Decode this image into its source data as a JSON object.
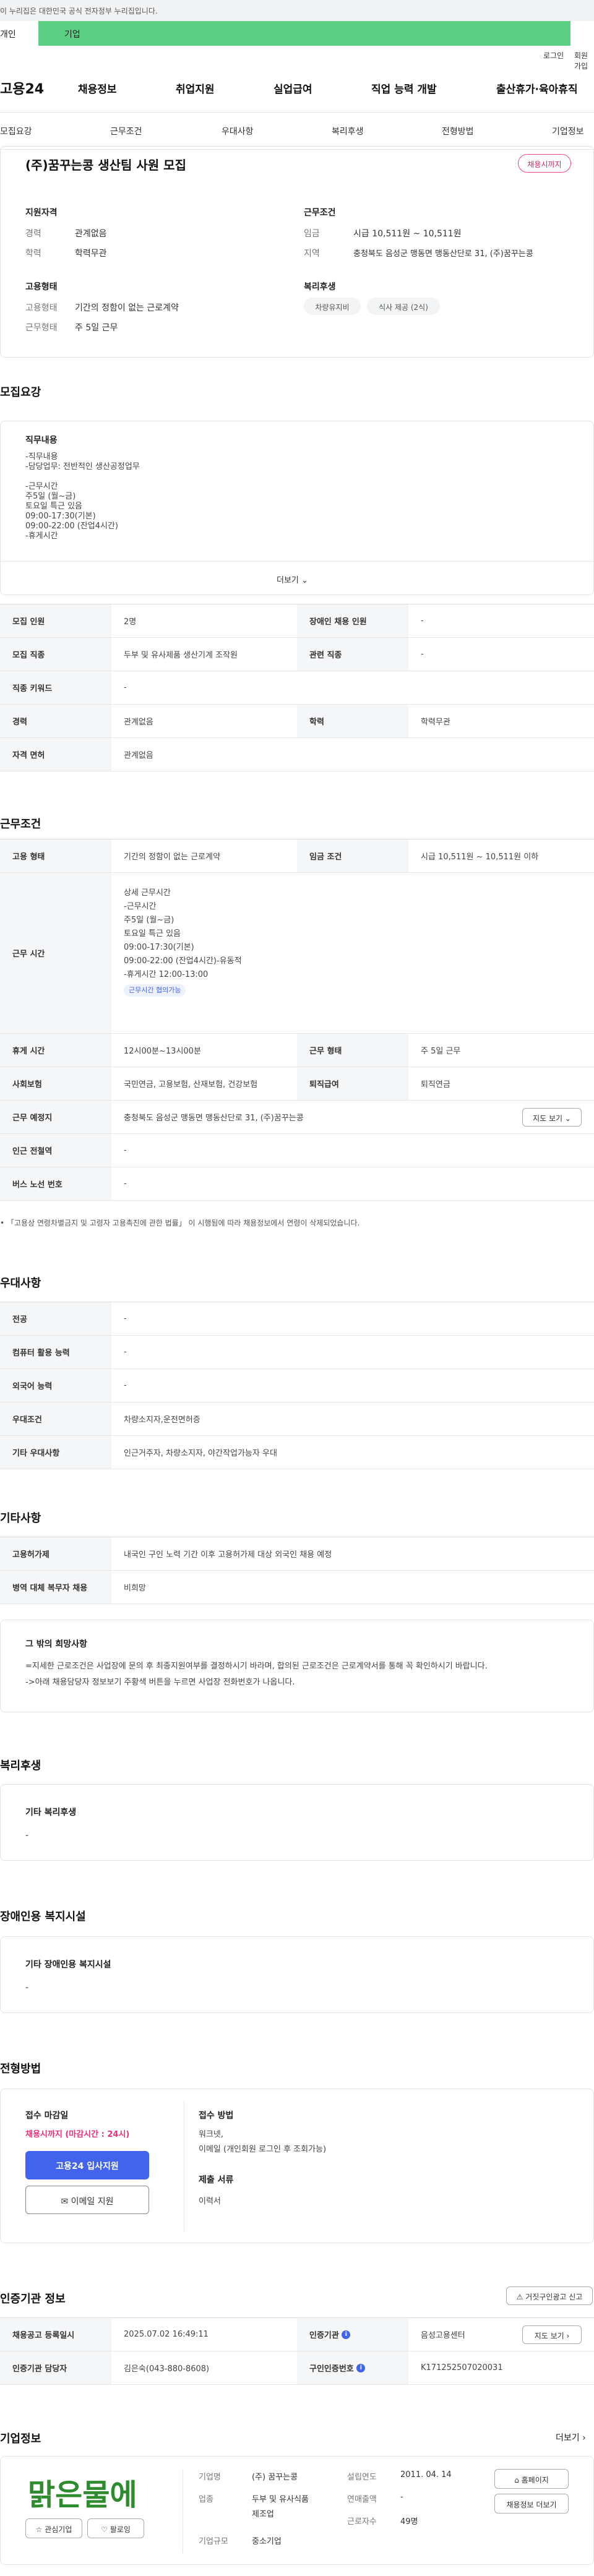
{
  "top_notice": "이 누리집은 대한민국 공식 전자정부 누리집입니다.",
  "tabs": {
    "individual": "개인",
    "business": "기업"
  },
  "util": {
    "login": "로그인",
    "join": "회원가입"
  },
  "logo": "고용24",
  "gnb": [
    "채용정보",
    "취업지원",
    "실업급여",
    "직업 능력 개발",
    "출산휴가·육아휴직"
  ],
  "subnav": [
    "모집요강",
    "근무조건",
    "우대사항",
    "복리후생",
    "전형방법",
    "기업정보"
  ],
  "header": {
    "title": "(주)꿈꾸는콩 생산팀 사원 모집",
    "status_badge": "채용시까지",
    "qual_title": "지원자격",
    "qual": [
      {
        "k": "경력",
        "v": "관계없음"
      },
      {
        "k": "학력",
        "v": "학력무관"
      }
    ],
    "cond_title": "근무조건",
    "cond": [
      {
        "k": "임금",
        "v": "시급 10,511원 ~ 10,511원"
      },
      {
        "k": "지역",
        "v": "충청북도 음성군 맹동면 맹동산단로 31, (주)꿈꾸는콩"
      }
    ],
    "emp_title": "고용형태",
    "emp": [
      {
        "k": "고용형태",
        "v": "기간의 정함이 없는 근로계약"
      },
      {
        "k": "근무형태",
        "v": "주 5일 근무"
      }
    ],
    "welfare_title": "복리후생",
    "welfare_pills": [
      "차량유지비",
      "식사 제공 (2식)"
    ]
  },
  "recruit": {
    "heading": "모집요강",
    "job_title": "직무내용",
    "job_lines": [
      "-직무내용",
      "-담당업무: 전반적인 생산공정업무",
      "",
      "-근무시간",
      "주5일 (월~금)",
      "토요일 특근 있음",
      "09:00-17:30(기본)",
      "09:00-22:00 (잔업4시간)",
      "-휴게시간"
    ],
    "more": "더보기",
    "rows": [
      {
        "th1": "모집 인원",
        "td1": "2명",
        "th2": "장애인 채용 인원",
        "td2": "-"
      },
      {
        "th1": "모집 직종",
        "td1": "두부 및 유사제품 생산기계 조작원",
        "th2": "관련 직종",
        "td2": "-"
      },
      {
        "th1": "직종 키워드",
        "td1": "-"
      },
      {
        "th1": "경력",
        "td1": "관계없음",
        "th2": "학력",
        "td2": "학력무관"
      },
      {
        "th1": "자격 면허",
        "td1": "관계없음"
      }
    ]
  },
  "work": {
    "heading": "근무조건",
    "emp_type_label": "고용 형태",
    "emp_type": "기간의 정함이 없는 근로계약",
    "wage_label": "임금 조건",
    "wage": "시급 10,511원 ~ 10,511원 이하",
    "hours_label": "근무 시간",
    "hours_lines": [
      "상세 근무시간",
      "-근무시간",
      "주5일 (월~금)",
      "토요일 특근 있음",
      "09:00-17:30(기본)",
      "09:00-22:00 (잔업4시간)-유동적",
      "-휴게시간 12:00-13:00"
    ],
    "hours_tag": "근무시간 협의가능",
    "break_label": "휴게 시간",
    "break": "12시00분~13시00분",
    "shift_label": "근무 형태",
    "shift": "주 5일 근무",
    "insurance_label": "사회보험",
    "insurance": "국민연금, 고용보험, 산재보험, 건강보험",
    "retire_label": "퇴직급여",
    "retire": "퇴직연금",
    "place_label": "근무 예정지",
    "place": "충청북도 음성군 맹동면 맹동산단로 31, (주)꿈꾸는콩",
    "map_btn": "지도 보기",
    "subway_label": "인근 전철역",
    "subway": "-",
    "bus_label": "버스 노선 번호",
    "bus": "-",
    "note": "「고용상 연령차별금지 및 고령자 고용촉진에 관한 법률」 이 시행됨에 따라 채용정보에서 연령이 삭제되었습니다."
  },
  "pref": {
    "heading": "우대사항",
    "rows": [
      {
        "th": "전공",
        "td": "-"
      },
      {
        "th": "컴퓨터 활용 능력",
        "td": "-"
      },
      {
        "th": "외국어 능력",
        "td": "-"
      },
      {
        "th": "우대조건",
        "td": "차량소지자,운전면허증"
      },
      {
        "th": "기타 우대사항",
        "td": "인근거주자, 차량소지자, 야간작업가능자 우대"
      }
    ]
  },
  "etc": {
    "heading": "기타사항",
    "rows": [
      {
        "th": "고용허가제",
        "td": "내국인 구인 노력 기간 이후 고용허가제 대상 외국인 채용 예정"
      },
      {
        "th": "병역 대체 복무자 채용",
        "td": "비희망"
      }
    ],
    "extra_title": "그 밖의 희망사항",
    "extra_lines": [
      "=지세한 근로조건은 사업장에 문의 후 최종지원여부를 결정하시기 바라며, 합의된 근로조건은 근로계약서를 통해 꼭 확인하시기 바랍니다.",
      "->아래 채용담당자 정보보기 주황색 버튼을 누르면 사업장 전화번호가 나옵니다."
    ]
  },
  "benefit": {
    "heading": "복리후생",
    "box_title": "기타 복리후생",
    "box_value": "-"
  },
  "disability": {
    "heading": "장애인용 복지시설",
    "box_title": "기타 장애인용 복지시설",
    "box_value": "-"
  },
  "selection": {
    "heading": "전형방법",
    "deadline_label": "접수 마감일",
    "deadline_value": "채용시까지 (마감시간 : 24시)",
    "apply_btn": "고용24 입사지원",
    "email_btn": "이메일 지원",
    "method_label": "접수 방법",
    "method_lines": [
      "워크넷,",
      "이메일 (개인회원 로그인 후 조회가능)"
    ],
    "docs_label": "제출 서류",
    "docs_value": "이력서"
  },
  "cert": {
    "heading": "인증기관 정보",
    "report_btn": "거짓구인광고 신고",
    "reg_label": "채용공고 등록일시",
    "reg_value": "2025.07.02 16:49:11",
    "agency_label": "인증기관",
    "agency_value": "음성고용센터",
    "map_btn": "지도 보기",
    "manager_label": "인증기관 담당자",
    "manager_value": "김은숙(043-880-8608)",
    "job_no_label": "구인인증번호",
    "job_no_value": "K171252507020031"
  },
  "company": {
    "heading": "기업정보",
    "more": "더보기",
    "logo_text": "맑은물에",
    "fav_btn": "관심기업",
    "follow_btn": "팔로잉",
    "name_label": "기업명",
    "name_value": "(주) 꿈꾸는콩",
    "industry_label": "업종",
    "industry_lines": [
      "두부 및 유사식품",
      "제조업"
    ],
    "size_label": "기업규모",
    "size_value": "중소기업",
    "founded_label": "설립연도",
    "founded_value": "2011. 04. 14",
    "revenue_label": "연매출액",
    "revenue_value": "-",
    "staff_label": "근로자수",
    "staff_value": "49명",
    "homepage_btn": "홈페이지",
    "more_jobs_btn": "채용정보 더보기"
  }
}
